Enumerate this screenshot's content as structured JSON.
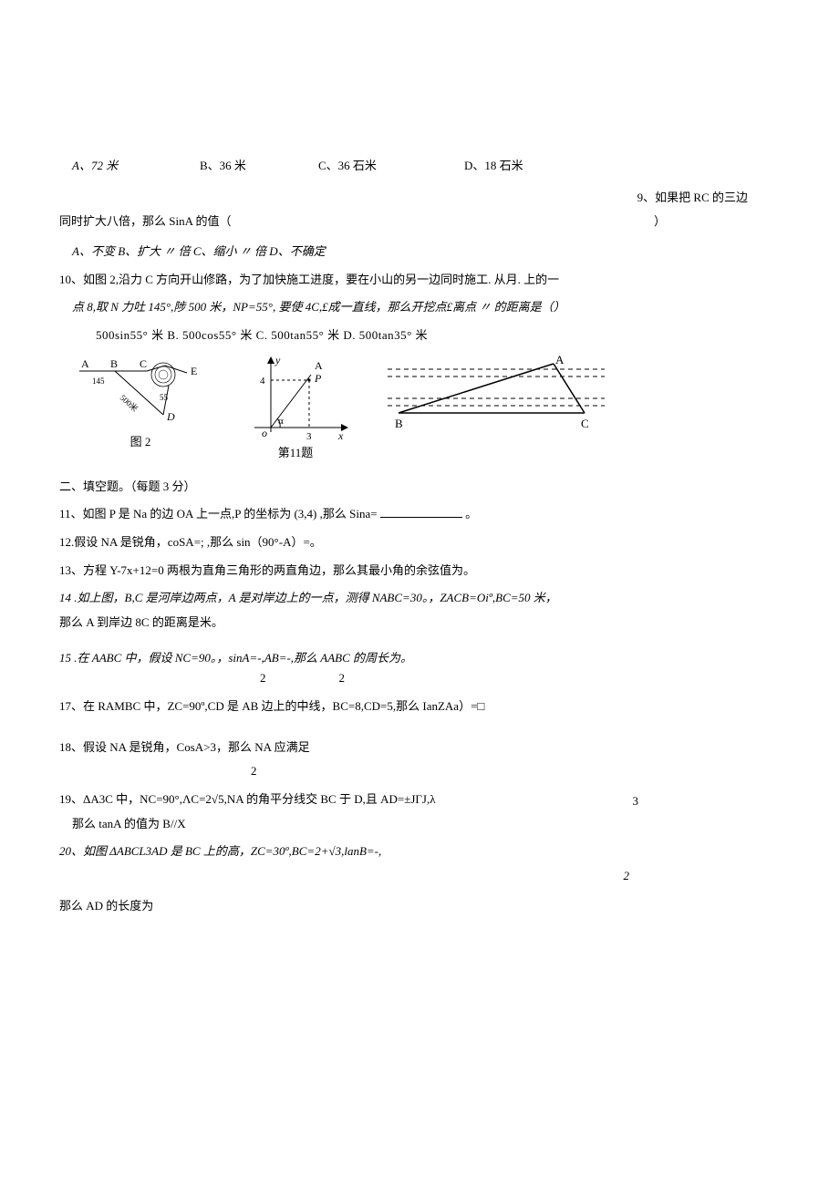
{
  "q8": {
    "optA": "A、72 米",
    "optB": "B、36 米",
    "optC": "C、36 石米",
    "optD": "D、18 石米"
  },
  "q9": {
    "lead": "9、如果把 RC 的三边",
    "line2": "同时扩大八倍，那么 SinA 的值（",
    "paren_close": "）",
    "opts": "A、不变 B、扩大 〃 倍 C、缩小 〃 倍 D、不确定"
  },
  "q10": {
    "l1": "10、如图 2,沿力 C 方向开山修路，为了加快施工进度，要在小山的另一边同时施工. 从月. 上的一",
    "l2": "点 8,取 N 力吐 145°,陟 500 米，NP=55°, 要使 4C,£成一直线，那么开挖点£离点 〃 的距离是（）",
    "choices": "500sin55° 米   B. 500cos55° 米    C. 500tan55° 米    D. 500tan35° 米"
  },
  "fig": {
    "fig2": "图 2",
    "q11": "第11题",
    "labels2": {
      "A": "A",
      "B": "B",
      "C": "C",
      "E": "E",
      "D": "D",
      "angle": "145",
      "len": "500米",
      "ang2": "55"
    },
    "labels11": {
      "y": "y",
      "A": "A",
      "P": "P",
      "O": "o",
      "alpha": "α",
      "x": "x",
      "three": "3",
      "four": "4"
    },
    "labelsR": {
      "A": "A",
      "B": "B",
      "C": "C"
    }
  },
  "section2": "二、填空题。（每题 3 分）",
  "q11": {
    "text_a": "11、如图 P 是 Na 的边 OA 上一点,P 的坐标为 (3,4) ,那么 Sina=",
    "text_b": "。"
  },
  "q12": "12.假设 NA 是锐角，coSA=; ,那么 sin（90°-A）=。",
  "q13": "13、方程 Y-7x+12=0 两根为直角三角形的两直角边，那么其最小角的余弦值为。",
  "q14": {
    "l1": "14 .如上图，B,C 是河岸边两点，A 是对岸边上的一点，测得 NABC=30。，ZACB=Oiº,BC=50 米，",
    "l2": "那么 A 到岸边 8C 的距离是米。"
  },
  "q15": {
    "l1": "15 .在 AABC 中，假设 NC=90。，sinA=-,AB=-,那么 AABC 的周长为。",
    "frac_a": "2",
    "frac_b": "2"
  },
  "q17": "17、在 RAMBC 中，ZC=90º,CD 是 AB 边上的中线，BC=8,CD=5,那么 IanZAa）=□",
  "q18": {
    "l1": "18、假设 NA 是锐角，CosA>3，那么 NA 应满足",
    "frac": "2"
  },
  "q19": {
    "l1": "19、ΔA3C 中，NC=90°,ΛC=2√5,NA 的角平分线交 BC 于 D,且 AD=±JΓJ,λ",
    "rnum": "3",
    "l2": "那么 tanA 的值为 B//X"
  },
  "q20": {
    "l1": "20、如图 ΔABCL3AD 是 BC 上的高，ZC=30º,BC=2+√3,lanB=-,",
    "frac": "2",
    "l2": "那么 AD 的长度为"
  }
}
